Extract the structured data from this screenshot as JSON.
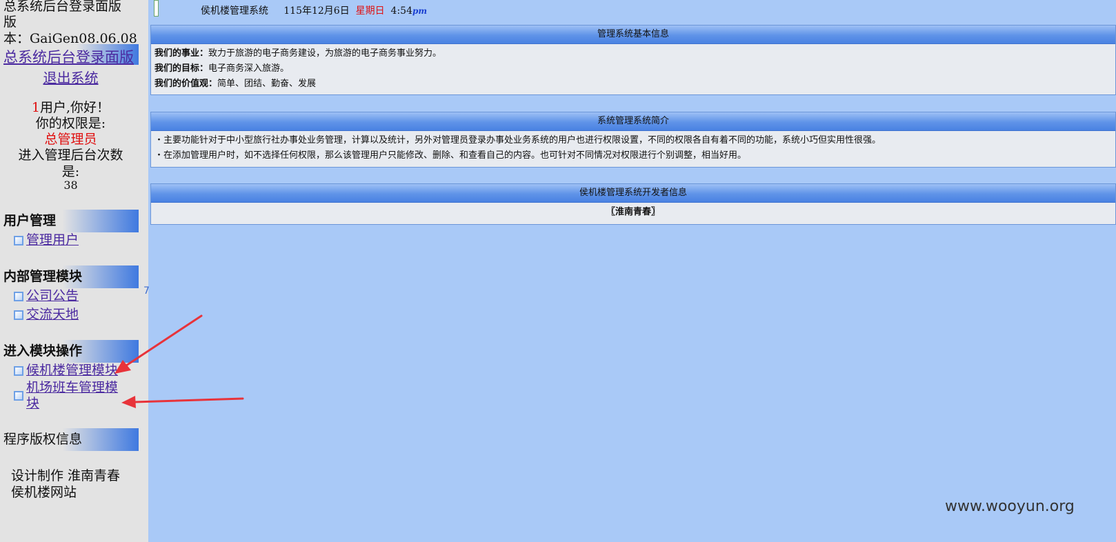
{
  "sidebar": {
    "header_lines": [
      "总系统后台登录面版",
      "版",
      "本：GaiGen08.06.08"
    ],
    "title_link": "总系统后台登录面版",
    "logout": "退出系统",
    "user_id": "1",
    "greeting_suffix": "用户,你好！",
    "permission_label": "你的权限是:",
    "permission_value": "总管理员",
    "visits_label_1": "进入管理后台次数",
    "visits_label_2": "是:",
    "visits_count": "38",
    "sections": [
      {
        "title": "用户管理",
        "items": [
          "管理用户"
        ]
      },
      {
        "title": "内部管理模块",
        "items": [
          "公司公告",
          "交流天地"
        ]
      },
      {
        "title": "进入模块操作",
        "items": [
          "候机楼管理模块",
          "机场班车管理模",
          "块"
        ]
      },
      {
        "title": "程序版权信息",
        "items": []
      }
    ],
    "footer_lines": [
      "设计制作 淮南青春",
      "侯机楼网站"
    ]
  },
  "topbar": {
    "system_name": "侯机楼管理系统",
    "date": "115年12月6日",
    "weekday": "星期日",
    "time": "4:54",
    "ampm": "pm"
  },
  "panels": [
    {
      "title": "管理系统基本信息",
      "rows": [
        {
          "label": "我们的事业：",
          "text": "致力于旅游的电子商务建设，为旅游的电子商务事业努力。"
        },
        {
          "label": "我们的目标：",
          "text": "电子商务深入旅游。"
        },
        {
          "label": "我们的价值观：",
          "text": "简单、团结、勤奋、发展"
        }
      ]
    },
    {
      "title": "系统管理系统简介",
      "rows": [
        {
          "text": "・主要功能针对于中小型旅行社办事处业务管理，计算以及统计，另外对管理员登录办事处业务系统的用户也进行权限设置，不同的权限各自有着不同的功能，系统小巧但实用性很强。"
        },
        {
          "text": "・在添加管理用户时，如不选择任何权限，那么该管理用户只能修改、删除、和查看自己的内容。也可针对不同情况对权限进行个别调整，相当好用。"
        }
      ]
    },
    {
      "title": "侯机楼管理系统开发者信息",
      "rows": [
        {
          "text": "〖淮南青春〗"
        }
      ]
    }
  ],
  "stray_char": "7",
  "watermark": "www.wooyun.org",
  "colors": {
    "page_bg": "#a9c9f7",
    "sidebar_bg": "#e3e3e3",
    "link": "#4b2aa0",
    "accent_red": "#e01010",
    "arrow": "#e8333a"
  }
}
